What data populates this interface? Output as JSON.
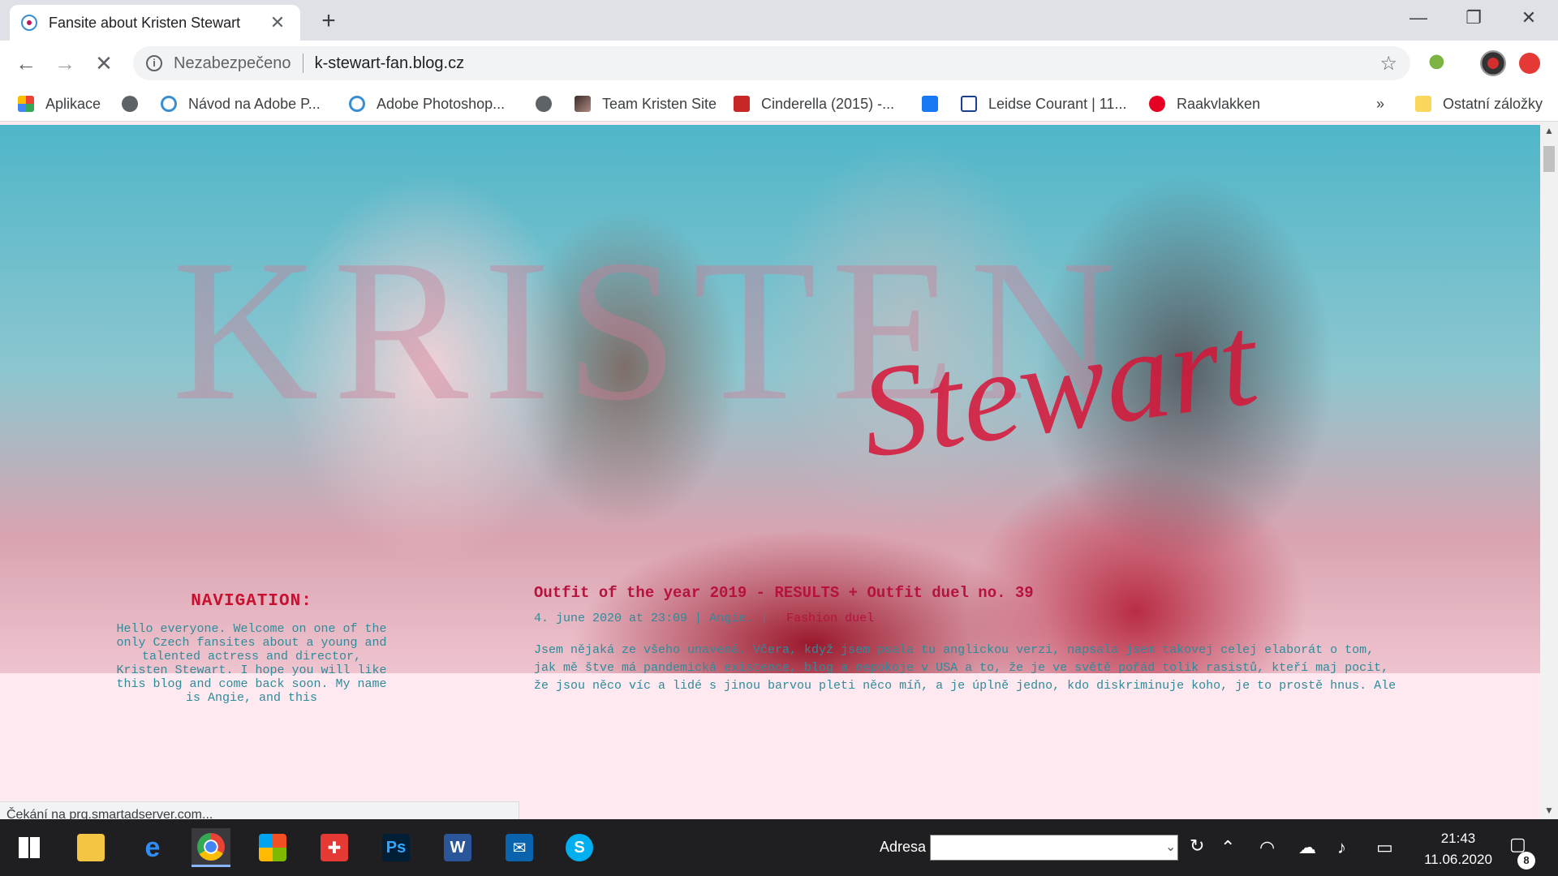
{
  "browser": {
    "tab_title": "Fansite about Kristen Stewart",
    "tab_close_glyph": "✕",
    "new_tab_glyph": "+",
    "window_controls": {
      "minimize": "—",
      "restore": "❐",
      "close": "✕"
    },
    "nav": {
      "back": "←",
      "forward": "→",
      "stop": "✕"
    },
    "security_label": "Nezabezpečeno",
    "url": "k-stewart-fan.blog.cz",
    "star_glyph": "☆"
  },
  "bookmarks": {
    "items": [
      {
        "label": "Aplikace",
        "icon": "apps-grid-icon"
      },
      {
        "label": "",
        "icon": "globe-icon"
      },
      {
        "label": "Návod na Adobe P...",
        "icon": "blog-favicon-icon"
      },
      {
        "label": "Adobe Photoshop...",
        "icon": "blog-favicon-icon"
      },
      {
        "label": "",
        "icon": "globe-icon"
      },
      {
        "label": "Team Kristen Site",
        "icon": "image-favicon-icon"
      },
      {
        "label": "Cinderella (2015) -...",
        "icon": "red-f-favicon-icon"
      },
      {
        "label": "",
        "icon": "facebook-icon"
      },
      {
        "label": "Leidse Courant | 11...",
        "icon": "document-icon"
      },
      {
        "label": "Raakvlakken",
        "icon": "pinterest-icon"
      }
    ],
    "overflow": "»",
    "other_label": "Ostatní záložky"
  },
  "page": {
    "banner_name": "KRISTEN",
    "banner_surname": "Stewart",
    "sidebar": {
      "heading": "NAVIGATION:",
      "intro": "Hello everyone. Welcome on one of the only Czech fansites about a young and talented actress and director, Kristen Stewart. I hope you will like this blog and come back soon. My name is Angie, and this"
    },
    "article": {
      "title": "Outfit of the year 2019 - RESULTS + Outfit duel no. 39",
      "date": "4. june 2020 at 23:09",
      "author": "Angie.",
      "category": "Fashion duel",
      "body": "Jsem nějaká ze všeho unavená. Včera, když jsem psala tu anglickou verzi, napsala jsem takovej celej elaborát o tom, jak mě štve má pandemická existence, blog a nepokoje v USA a to, že je ve světě pořád tolik rasistů, kteří maj pocit, že jsou něco víc a lidé s jinou barvou pleti něco míň, a je úplně jedno, kdo diskriminuje koho, je to prostě hnus. Ale"
    }
  },
  "status_bar": "Čekání na prg.smartadserver.com...",
  "taskbar": {
    "address_label": "Adresa",
    "address_value": "",
    "time": "21:43",
    "date": "11.06.2020",
    "notification_count": "8"
  },
  "colors": {
    "accent_red": "#c8102e",
    "teal_text": "#2e8b9a",
    "page_bg": "#fde9ef"
  }
}
